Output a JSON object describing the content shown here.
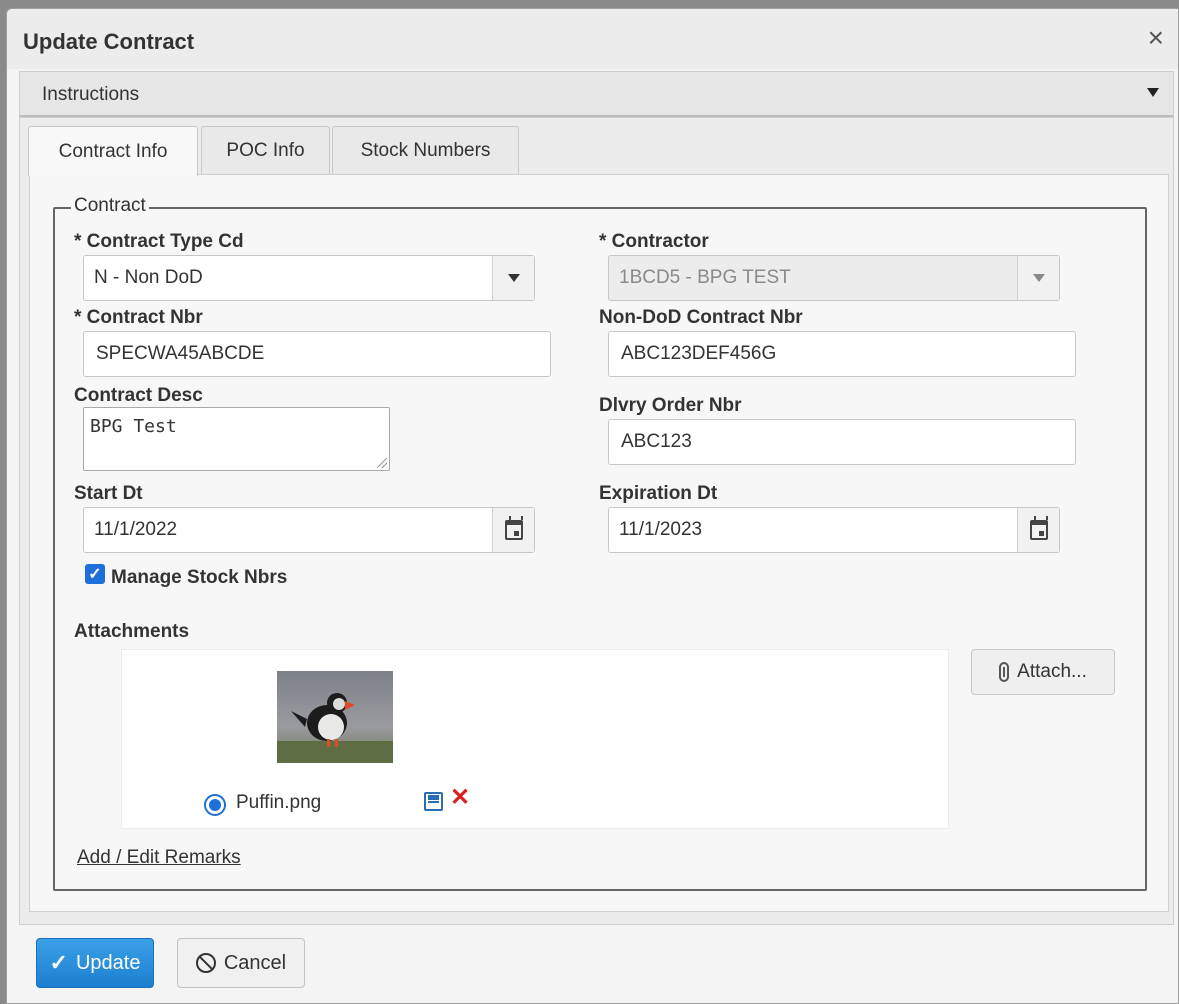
{
  "dialog": {
    "title": "Update Contract",
    "close_glyph": "×"
  },
  "instructions": {
    "label": "Instructions"
  },
  "tabs": [
    {
      "label": "Contract Info",
      "active": true
    },
    {
      "label": "POC Info",
      "active": false
    },
    {
      "label": "Stock Numbers",
      "active": false
    }
  ],
  "contract": {
    "legend": "Contract",
    "contract_type": {
      "label": "* Contract Type Cd",
      "value": "N - Non DoD"
    },
    "contractor": {
      "label": "* Contractor",
      "value": "1BCD5 - BPG TEST",
      "disabled": true
    },
    "contract_nbr": {
      "label": "* Contract Nbr",
      "value": "SPECWA45ABCDE"
    },
    "non_dod_contract_nbr": {
      "label": "Non-DoD Contract Nbr",
      "value": "ABC123DEF456G"
    },
    "contract_desc": {
      "label": "Contract Desc",
      "value": "BPG Test"
    },
    "dlvry_order_nbr": {
      "label": "Dlvry Order Nbr",
      "value": "ABC123"
    },
    "start_dt": {
      "label": "Start Dt",
      "value": "11/1/2022"
    },
    "expiration_dt": {
      "label": "Expiration Dt",
      "value": "11/1/2023"
    },
    "manage_stock_nbrs": {
      "label": "Manage Stock Nbrs",
      "checked": true,
      "check_glyph": "✓"
    },
    "attachments": {
      "label": "Attachments",
      "files": [
        {
          "name": "Puffin.png",
          "selected": true,
          "thumbnail_icon": "puffin-image"
        }
      ],
      "attach_button": "Attach...",
      "delete_glyph": "✕"
    },
    "remarks_link": "Add / Edit Remarks"
  },
  "footer": {
    "update_label": "Update",
    "update_glyph": "✓",
    "cancel_label": "Cancel"
  },
  "colors": {
    "accent": "#1e6fd9",
    "update_button": "#2b8fdc",
    "delete": "#d82121"
  }
}
